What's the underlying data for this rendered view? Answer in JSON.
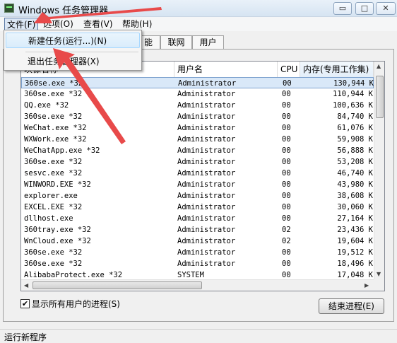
{
  "window": {
    "title": "Windows 任务管理器",
    "minimize": "▭",
    "maximize": "□",
    "close": "✕"
  },
  "menubar": {
    "items": [
      {
        "label": "文件(F)"
      },
      {
        "label": "选项(O)"
      },
      {
        "label": "查看(V)"
      },
      {
        "label": "帮助(H)"
      }
    ]
  },
  "file_menu": {
    "items": [
      {
        "label": "新建任务(运行...)(N)"
      },
      {
        "label": "退出任务管理器(X)"
      }
    ]
  },
  "tabs": [
    {
      "label": "能"
    },
    {
      "label": "联网"
    },
    {
      "label": "用户"
    }
  ],
  "table": {
    "columns": [
      {
        "label": "映像名称"
      },
      {
        "label": "用户名"
      },
      {
        "label": "CPU"
      },
      {
        "label": "内存(专用工作集)"
      }
    ],
    "rows": [
      {
        "name": "360se.exe *32",
        "user": "Administrator",
        "cpu": "00",
        "mem": "130,944 K"
      },
      {
        "name": "360se.exe *32",
        "user": "Administrator",
        "cpu": "00",
        "mem": "110,944 K"
      },
      {
        "name": "QQ.exe *32",
        "user": "Administrator",
        "cpu": "00",
        "mem": "100,636 K"
      },
      {
        "name": "360se.exe *32",
        "user": "Administrator",
        "cpu": "00",
        "mem": "84,740 K"
      },
      {
        "name": "WeChat.exe *32",
        "user": "Administrator",
        "cpu": "00",
        "mem": "61,076 K"
      },
      {
        "name": "WXWork.exe *32",
        "user": "Administrator",
        "cpu": "00",
        "mem": "59,908 K"
      },
      {
        "name": "WeChatApp.exe *32",
        "user": "Administrator",
        "cpu": "00",
        "mem": "56,888 K"
      },
      {
        "name": "360se.exe *32",
        "user": "Administrator",
        "cpu": "00",
        "mem": "53,208 K"
      },
      {
        "name": "sesvc.exe *32",
        "user": "Administrator",
        "cpu": "00",
        "mem": "46,740 K"
      },
      {
        "name": "WINWORD.EXE *32",
        "user": "Administrator",
        "cpu": "00",
        "mem": "43,980 K"
      },
      {
        "name": "explorer.exe",
        "user": "Administrator",
        "cpu": "00",
        "mem": "38,608 K"
      },
      {
        "name": "EXCEL.EXE *32",
        "user": "Administrator",
        "cpu": "00",
        "mem": "30,060 K"
      },
      {
        "name": "dllhost.exe",
        "user": "Administrator",
        "cpu": "00",
        "mem": "27,164 K"
      },
      {
        "name": "360tray.exe *32",
        "user": "Administrator",
        "cpu": "02",
        "mem": "23,436 K"
      },
      {
        "name": "WnCloud.exe *32",
        "user": "Administrator",
        "cpu": "02",
        "mem": "19,604 K"
      },
      {
        "name": "360se.exe *32",
        "user": "Administrator",
        "cpu": "00",
        "mem": "19,512 K"
      },
      {
        "name": "360se.exe *32",
        "user": "Administrator",
        "cpu": "00",
        "mem": "18,496 K"
      },
      {
        "name": "AlibabaProtect.exe *32",
        "user": "SYSTEM",
        "cpu": "00",
        "mem": "17,048 K"
      }
    ]
  },
  "show_all_users": {
    "label": "显示所有用户的进程(S)",
    "checked": true
  },
  "end_process_button": "结束进程(E)",
  "status_text": "运行新程序",
  "colors": {
    "arrow": "#e84a4a",
    "selection": "#d9e8f8"
  }
}
